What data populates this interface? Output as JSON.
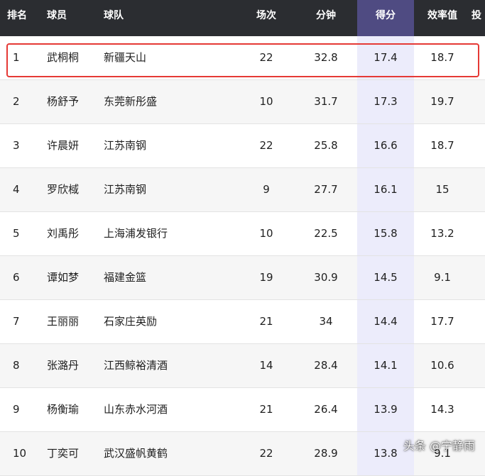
{
  "columns": {
    "rank": "排名",
    "player": "球员",
    "team": "球队",
    "games": "场次",
    "minutes": "分钟",
    "points": "得分",
    "efficiency": "效率值",
    "more": "投"
  },
  "rows": [
    {
      "rank": "1",
      "player": "武桐桐",
      "team": "新疆天山",
      "games": "22",
      "minutes": "32.8",
      "points": "17.4",
      "efficiency": "18.7"
    },
    {
      "rank": "2",
      "player": "杨舒予",
      "team": "东莞新彤盛",
      "games": "10",
      "minutes": "31.7",
      "points": "17.3",
      "efficiency": "19.7"
    },
    {
      "rank": "3",
      "player": "许晨妍",
      "team": "江苏南钢",
      "games": "22",
      "minutes": "25.8",
      "points": "16.6",
      "efficiency": "18.7"
    },
    {
      "rank": "4",
      "player": "罗欣棫",
      "team": "江苏南钢",
      "games": "9",
      "minutes": "27.7",
      "points": "16.1",
      "efficiency": "15"
    },
    {
      "rank": "5",
      "player": "刘禹彤",
      "team": "上海浦发银行",
      "games": "10",
      "minutes": "22.5",
      "points": "15.8",
      "efficiency": "13.2"
    },
    {
      "rank": "6",
      "player": "谭如梦",
      "team": "福建金篮",
      "games": "19",
      "minutes": "30.9",
      "points": "14.5",
      "efficiency": "9.1"
    },
    {
      "rank": "7",
      "player": "王丽丽",
      "team": "石家庄英励",
      "games": "21",
      "minutes": "34",
      "points": "14.4",
      "efficiency": "17.7"
    },
    {
      "rank": "8",
      "player": "张潞丹",
      "team": "江西鲸裕清酒",
      "games": "14",
      "minutes": "28.4",
      "points": "14.1",
      "efficiency": "10.6"
    },
    {
      "rank": "9",
      "player": "杨衡瑜",
      "team": "山东赤水河酒",
      "games": "21",
      "minutes": "26.4",
      "points": "13.9",
      "efficiency": "14.3"
    },
    {
      "rank": "10",
      "player": "丁奕可",
      "team": "武汉盛帆黄鹤",
      "games": "22",
      "minutes": "28.9",
      "points": "13.8",
      "efficiency": "9.1"
    }
  ],
  "watermark": "头条 @宁静雨",
  "colors": {
    "header_bg": "#2b2d31",
    "sorted_header_bg": "#4f4b82",
    "sorted_cell_bg": "#ececfb",
    "highlight": "#e53935"
  }
}
